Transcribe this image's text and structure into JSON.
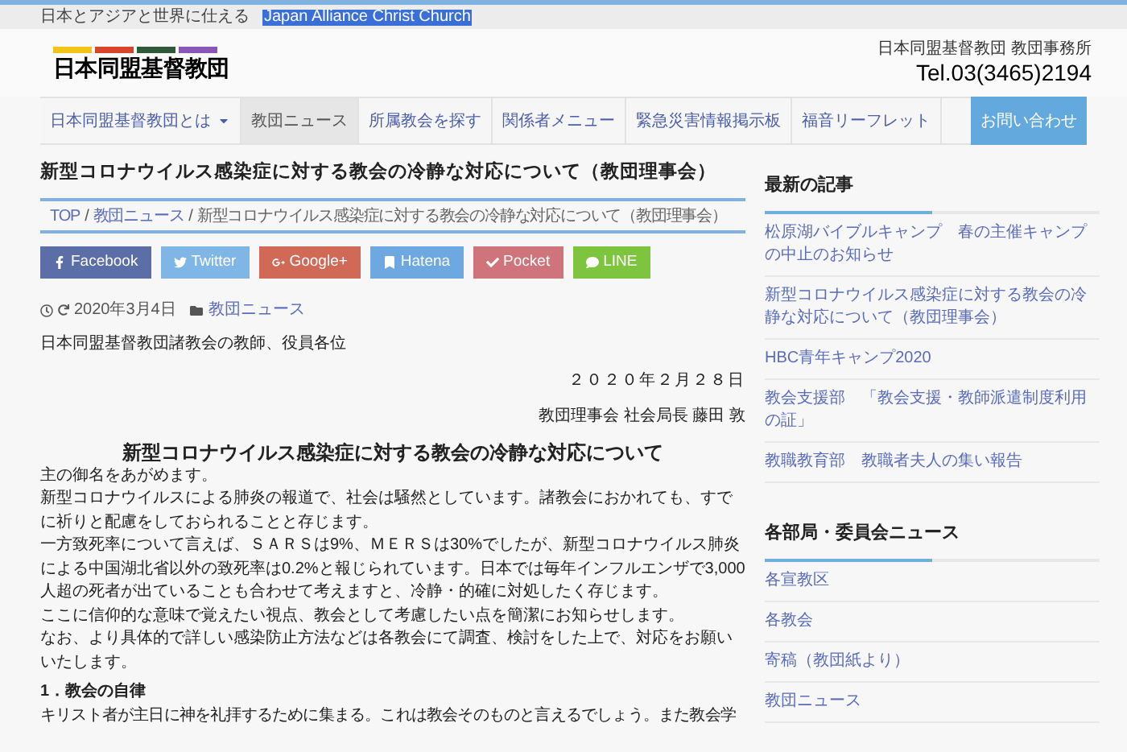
{
  "topbar": {
    "tagline": "日本とアジアと世界に仕える",
    "site_name_en": "Japan Alliance Christ Church",
    "site_name_selected": true
  },
  "header": {
    "logo_text": "日本同盟基督教団",
    "office": "日本同盟基督教団 教団事務所",
    "tel": "Tel.03(3465)2194"
  },
  "nav": [
    {
      "label": "日本同盟基督教団とは",
      "dropdown": true,
      "selected": false
    },
    {
      "label": "教団ニュース",
      "dropdown": false,
      "selected": true
    },
    {
      "label": "所属教会を探す",
      "dropdown": false,
      "selected": false
    },
    {
      "label": "関係者メニュー",
      "dropdown": false,
      "selected": false
    },
    {
      "label": "緊急災害情報掲示板",
      "dropdown": false,
      "selected": false
    },
    {
      "label": "福音リーフレット",
      "dropdown": false,
      "selected": false
    }
  ],
  "contact_button": "お問い合わせ",
  "article": {
    "title": "新型コロナウイルス感染症に対する教会の冷静な対応について（教団理事会）",
    "breadcrumb_separator": "/",
    "breadcrumb": [
      "TOP",
      "教団ニュース",
      "新型コロナウイルス感染症に対する教会の冷静な対応について（教団理事会）"
    ],
    "share": [
      {
        "kind": "facebook",
        "label": "Facebook"
      },
      {
        "kind": "twitter",
        "label": "Twitter"
      },
      {
        "kind": "googleplus",
        "label": "Google+"
      },
      {
        "kind": "hatena",
        "label": "Hatena"
      },
      {
        "kind": "pocket",
        "label": "Pocket"
      },
      {
        "kind": "line",
        "label": "LINE"
      }
    ],
    "date": "2020年3月4日",
    "category": "教団ニュース",
    "addressee": "日本同盟基督教団諸教会の教師、役員各位",
    "letter_date": "２０２０年２月２８日",
    "author": "教団理事会 社会局長 藤田 敦",
    "heading": "新型コロナウイルス感染症に対する教会の冷静な対応について",
    "paragraphs": [
      "主の御名をあがめます。",
      "新型コロナウイルスによる肺炎の報道で、社会は騒然としています。諸教会におかれても、すでに祈りと配慮をしておられることと存じます。",
      "一方致死率について言えば、ＳＡＲＳは9%、ＭＥＲＳは30%でしたが、新型コロナウイルス肺炎による中国湖北省以外の致死率は0.2%と報じられています。日本では毎年インフルエンザで3,000 人超の死者が出ていることも合わせて考えますと、冷静・的確に対処したく存じます。",
      "ここに信仰的な意味で覚えたい視点、教会として考慮したい点を簡潔にお知らせします。",
      "なお、より具体的で詳しい感染防止方法などは各教会にて調査、検討をした上で、対応をお願いいたします。"
    ],
    "section_title": "1．教会の自律",
    "section_text": "キリスト者が主日に神を礼拝するために集まる。これは教会そのものと言えるでしょう。また教会学"
  },
  "sidebar": [
    {
      "title": "最新の記事",
      "items": [
        "松原湖バイブルキャンプ　春の主催キャンプの中止のお知らせ",
        "新型コロナウイルス感染症に対する教会の冷静な対応について（教団理事会）",
        "HBC青年キャンプ2020",
        "教会支援部　「教会支援・教師派遣制度利用の証」",
        "教職教育部　教職者夫人の集い報告"
      ]
    },
    {
      "title": "各部局・委員会ニュース",
      "items": [
        "各宣教区",
        "各教会",
        "寄稿（教団紙より）",
        "教団ニュース"
      ]
    }
  ]
}
